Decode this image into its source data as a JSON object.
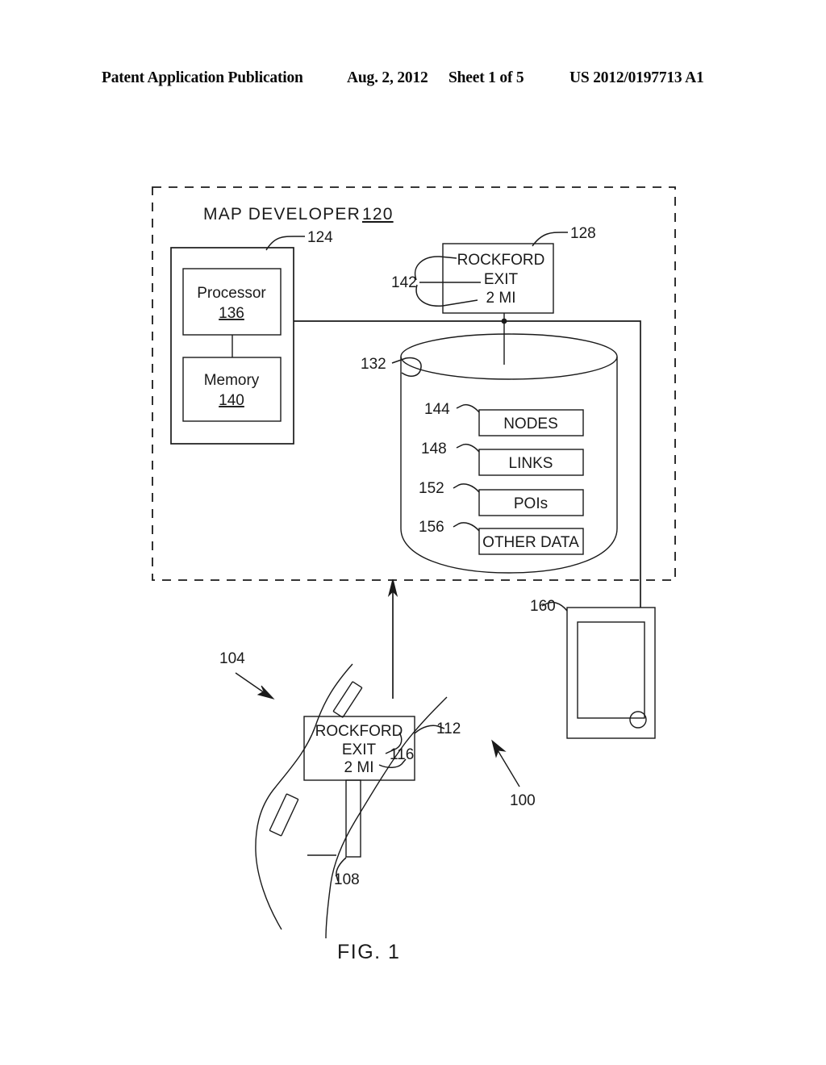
{
  "header": {
    "publication": "Patent Application Publication",
    "date": "Aug. 2, 2012",
    "sheet": "Sheet 1 of 5",
    "number": "US 2012/0197713 A1"
  },
  "figure": {
    "caption": "FIG. 1",
    "system_ref": "100"
  },
  "map_developer": {
    "title": "MAP DEVELOPER",
    "ref": "120",
    "server": {
      "ref": "124",
      "processor": {
        "label": "Processor",
        "ref": "136"
      },
      "memory": {
        "label": "Memory",
        "ref": "140"
      }
    },
    "captured_sign": {
      "ref": "128",
      "text_ref": "142",
      "lines": [
        "ROCKFORD",
        "EXIT",
        "2 MI"
      ]
    },
    "database": {
      "ref": "132",
      "records": [
        {
          "label": "NODES",
          "ref": "144"
        },
        {
          "label": "LINKS",
          "ref": "148"
        },
        {
          "label": "POIs",
          "ref": "152"
        },
        {
          "label": "OTHER DATA",
          "ref": "156"
        }
      ]
    },
    "mobile_device": {
      "ref": "160"
    }
  },
  "road_scene": {
    "road_ref": "104",
    "post_ref": "108",
    "sign": {
      "ref": "112",
      "text_ref": "116",
      "lines": [
        "ROCKFORD",
        "EXIT",
        "2 MI"
      ]
    }
  }
}
